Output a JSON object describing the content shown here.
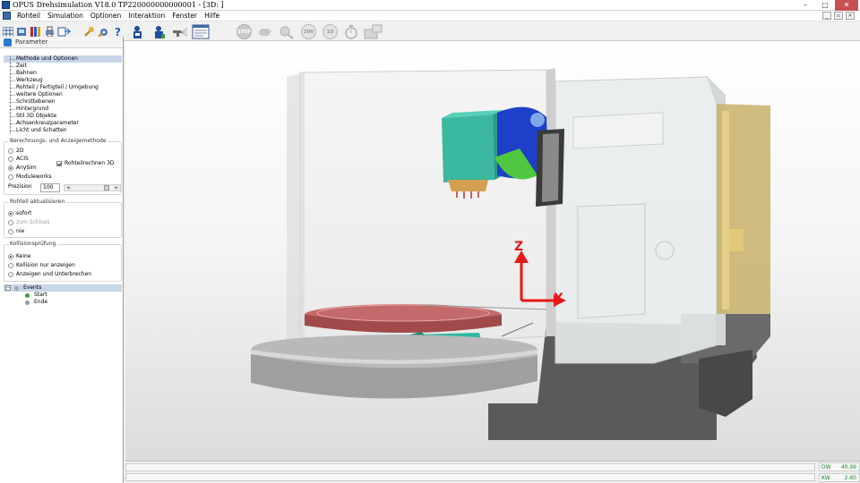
{
  "window": {
    "title": "OPUS Drehsimulation V18.0  TP220000000000001 - [3D: ]",
    "controls": [
      "–",
      "□",
      "✕"
    ]
  },
  "menu": {
    "items": [
      "Rohteil",
      "Simulation",
      "Optionen",
      "Interaktion",
      "Fenster",
      "Hilfe"
    ],
    "mdi_controls": [
      "_",
      "▫",
      "×"
    ]
  },
  "toolbar": {
    "stop_label": "STOP",
    "speed_200": "200",
    "speed_10": "10"
  },
  "panel": {
    "title": "Parameter",
    "nav": [
      "Methode und Optionen",
      "Zeit",
      "Bahnen",
      "Werkzeug",
      "Rohteil / Fertigteil / Umgebung",
      "weitere Optionen",
      "Schnittebenen",
      "Hintergrund",
      "Stil 3D Objekte",
      "Achsenkreuzparameter",
      "Licht und Schatten"
    ],
    "method_group": {
      "title": "Berechnungs- und Anzeigemethode",
      "options": [
        "2D",
        "ACIS",
        "AnySim",
        "Moduleworks"
      ],
      "selected": "AnySim",
      "checkbox_label": "Rohteilrechnen 3D",
      "checkbox_checked": true,
      "precision_label": "Prezision",
      "precision_value": "100"
    },
    "update_group": {
      "title": "Rohteil aktualisieren",
      "options": [
        "sofort",
        "zum Schluss",
        "nie"
      ],
      "selected": "sofort"
    },
    "collision_group": {
      "title": "Kollisionsprüfung",
      "options": [
        "Keine",
        "Kollision nur anzeigen",
        "Anzeigen und Unterbrechen"
      ],
      "selected": "Keine"
    },
    "events": {
      "label": "Events",
      "items": [
        "Start",
        "Ende"
      ]
    }
  },
  "viewport": {
    "axis_z": "Z",
    "axis_x": "X",
    "axis_color": "#e81818"
  },
  "status": {
    "dw_label": "DW",
    "dw_value": "40.99",
    "kw_label": "KW",
    "kw_value": "2.60"
  }
}
